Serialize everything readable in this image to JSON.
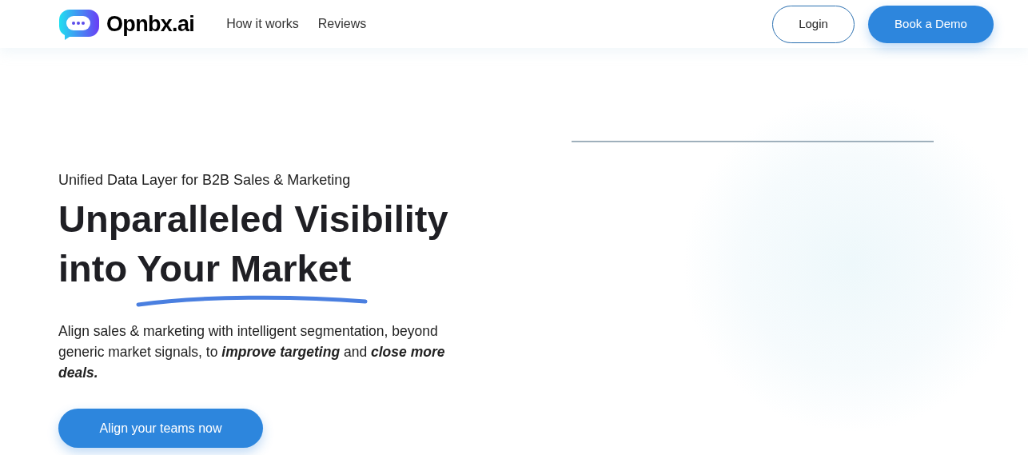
{
  "nav": {
    "brand": "Opnbx.ai",
    "links": [
      "How it works",
      "Reviews"
    ],
    "login": "Login",
    "demo": "Book a Demo"
  },
  "hero": {
    "eyebrow": "Unified Data Layer for B2B Sales & Marketing",
    "headline": "Unparalleled Visibility into",
    "highlight": "Your Market",
    "body": "Align sales & marketing with intelligent segmentation, beyond generic market signals, to **improve targeting** and **close more deals.**",
    "cta": "Align your teams now"
  }
}
